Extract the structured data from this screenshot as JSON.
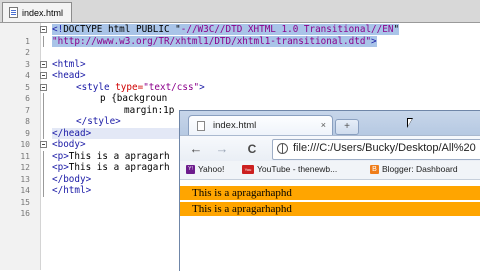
{
  "editor": {
    "tab_label": "index.html",
    "line_numbers": [
      "1",
      "2",
      "3",
      "4",
      "5",
      "6",
      "7",
      "8",
      "9",
      "10",
      "11",
      "12",
      "13",
      "14",
      "15",
      "16"
    ],
    "doctype_start": "<!",
    "doctype_text": "DOCTYPE html PUBLIC \"",
    "doctype_public_id": "-//W3C//DTD XHTML 1.0 Transitional//EN",
    "doctype_end": "\"",
    "doctype_dtd": "\"http://www.w3.org/TR/xhtml1/DTD/xhtml1-transitional.dtd\"",
    "doctype_close": ">",
    "html_open": "<html>",
    "head_open": "<head>",
    "style_open_tag": "<style",
    "style_attr": " type=",
    "style_attr_val": "\"text/css\"",
    "style_open_close": ">",
    "css_selector": "p",
    "css_rule_start": " {backgroun",
    "css_prop": "margin:1p",
    "style_close": "</style>",
    "head_close": "</head>",
    "body_open": "<body>",
    "p1_open": "<p>",
    "p1_text": "This is a apragarh",
    "p2_open": "<p>",
    "p2_text": "This is a apragarh",
    "body_close": "</body>",
    "html_close": "</html>"
  },
  "browser": {
    "tab_title": "index.html",
    "tab_close": "×",
    "new_tab": "+",
    "back_icon": "←",
    "forward_icon": "→",
    "reload_icon": "C",
    "address": "file:///C:/Users/Bucky/Desktop/All%20",
    "bookmarks": [
      {
        "icon": "Y!",
        "label": "Yahoo!",
        "color": "#6d1b8c"
      },
      {
        "icon": "You",
        "label": "YouTube - thenewb...",
        "color": "#cc2020"
      },
      {
        "icon": "B",
        "label": "Blogger: Dashboard",
        "color": "#ef7d1a"
      }
    ],
    "paragraphs": [
      "This is a apragarhaphd",
      "This is a apragarhaphd"
    ],
    "paragraph_bg": "#ffa500"
  }
}
